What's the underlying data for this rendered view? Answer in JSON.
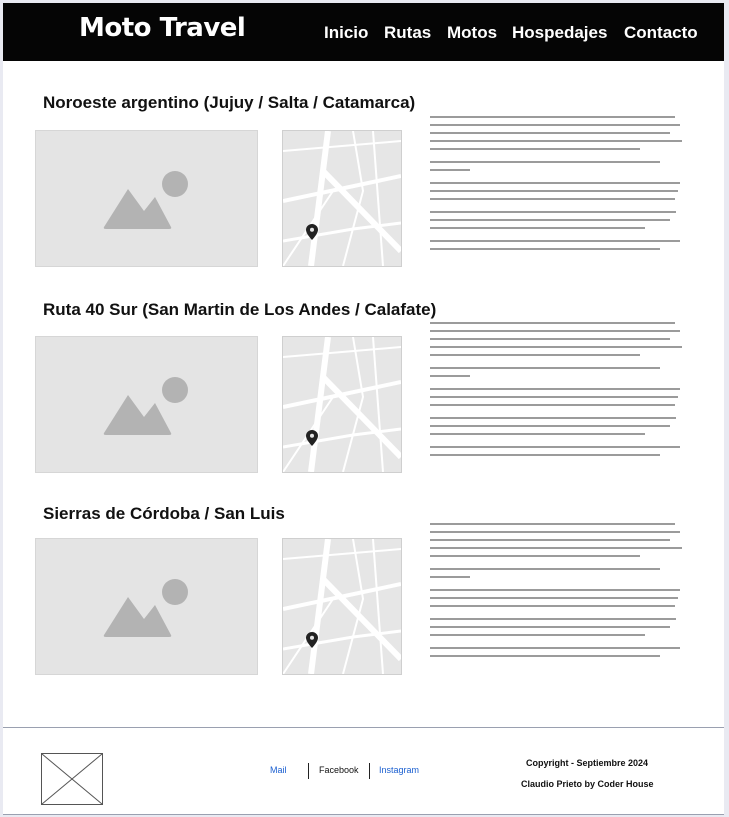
{
  "header": {
    "logo": "Moto Travel",
    "nav": [
      {
        "label": "Inicio"
      },
      {
        "label": "Rutas"
      },
      {
        "label": "Motos"
      },
      {
        "label": "Hospedajes"
      },
      {
        "label": "Contacto"
      }
    ]
  },
  "routes": [
    {
      "title": "Noroeste argentino (Jujuy / Salta / Catamarca)"
    },
    {
      "title": "Ruta 40 Sur (San Martin de Los Andes / Calafate)"
    },
    {
      "title": "Sierras de Córdoba / San Luis"
    }
  ],
  "footer": {
    "links": [
      {
        "label": "Mail",
        "color": "#1a5fd0"
      },
      {
        "label": "Facebook",
        "color": "#111111"
      },
      {
        "label": "Instagram",
        "color": "#1a5fd0"
      }
    ],
    "copyright": "Copyright - Septiembre 2024",
    "credit": "Claudio Prieto by Coder House"
  },
  "icons": [
    "image-placeholder-icon",
    "map-pin-icon",
    "logo-placeholder-icon"
  ]
}
